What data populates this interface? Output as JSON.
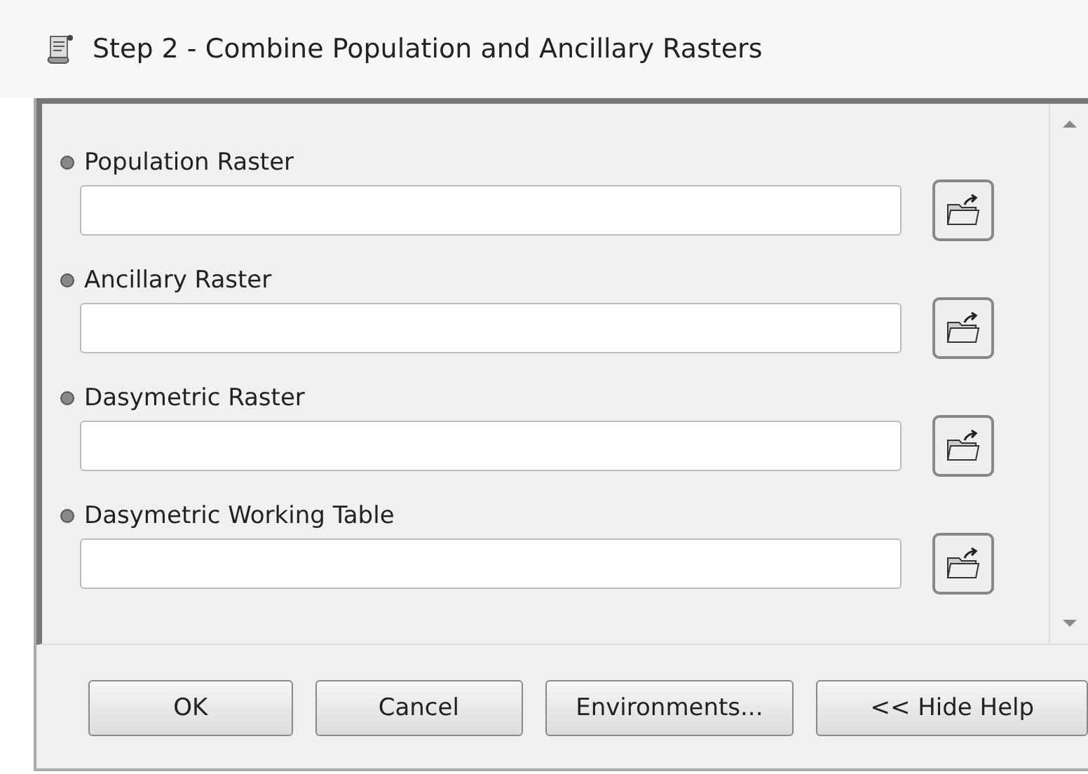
{
  "window": {
    "title": "Step 2 - Combine Population and Ancillary Rasters"
  },
  "parameters": [
    {
      "label": "Population Raster"
    },
    {
      "label": "Ancillary Raster"
    },
    {
      "label": "Dasymetric Raster"
    },
    {
      "label": "Dasymetric Working Table"
    }
  ],
  "buttons": [
    "OK",
    "Cancel",
    "Environments...",
    "<< Hide Help"
  ]
}
